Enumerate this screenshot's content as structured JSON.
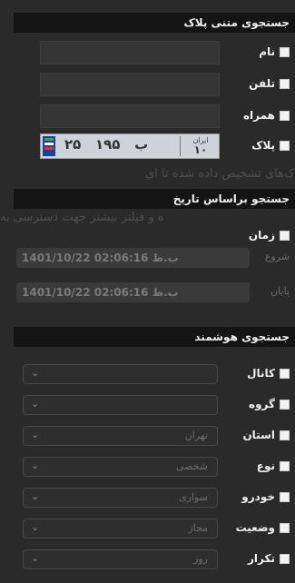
{
  "plate_section": {
    "title": "جستجوی متنی پلاک",
    "rows": [
      {
        "label": "نام"
      },
      {
        "label": "تلفن"
      },
      {
        "label": "همراه"
      },
      {
        "label": "پلاک"
      }
    ],
    "plate": {
      "right_number": "۲۵",
      "letter": "ب",
      "middle_number": "۱۹۵",
      "province_label": "ایران",
      "province_code": "۱۰"
    }
  },
  "overlay_text": {
    "line1": "پلاک‌های تشخیص داده شده تا ای",
    "line2": "ه و فیلتر بیشتر جهت دسترسی به"
  },
  "date_section": {
    "title": "جستجو براساس تاریخ",
    "time_label": "زمان",
    "start_label": "شروع",
    "start_value": "ب.ظ 02:06:16 1401/10/22",
    "end_label": "پایان",
    "end_value": "ب.ظ 02:06:16 1401/10/22"
  },
  "smart_section": {
    "title": "جستجوی هوشمند",
    "rows": [
      {
        "label": "کانال",
        "value": ""
      },
      {
        "label": "گروه",
        "value": ""
      },
      {
        "label": "استان",
        "value": "تهران"
      },
      {
        "label": "نوع",
        "value": "شخصی"
      },
      {
        "label": "خودرو",
        "value": "سواری"
      },
      {
        "label": "وضعیت",
        "value": "مجاز"
      },
      {
        "label": "تکرار",
        "value": "روز"
      }
    ]
  }
}
